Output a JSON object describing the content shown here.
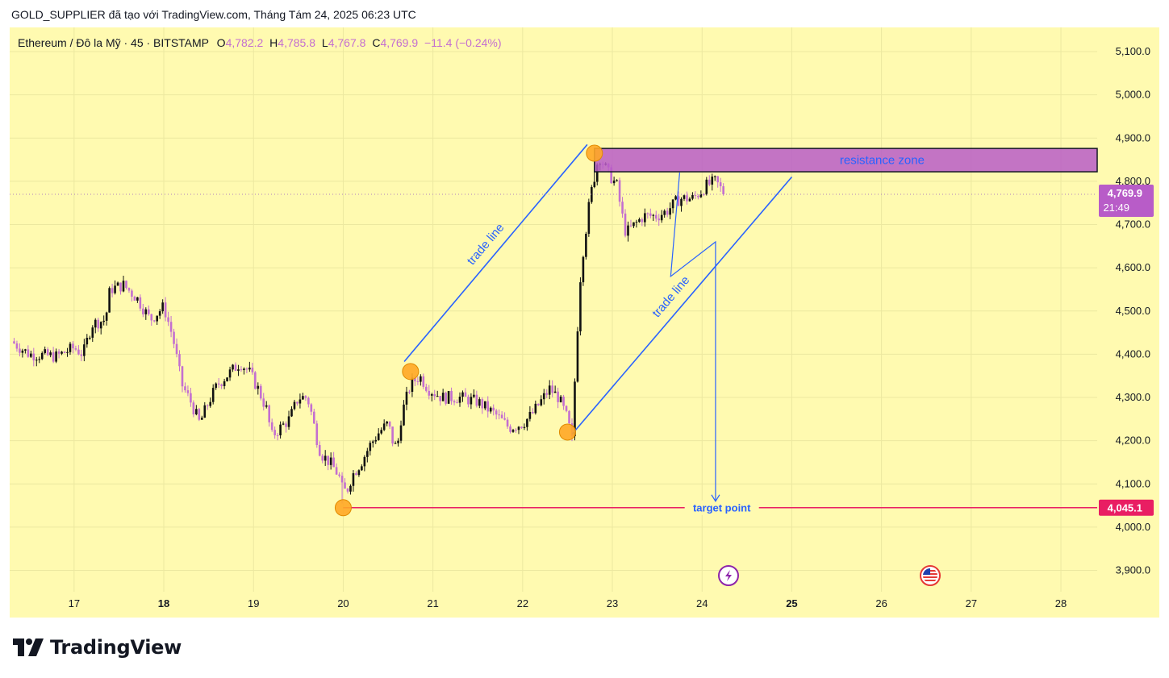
{
  "header": {
    "title": "GOLD_SUPPLIER đã tạo với TradingView.com, Tháng Tám 24, 2025 06:23 UTC"
  },
  "legend": {
    "symbol": "Ethereum / Đô la Mỹ · 45 · BITSTAMP",
    "o_label": "O",
    "o_value": "4,782.2",
    "h_label": "H",
    "h_value": "4,785.8",
    "l_label": "L",
    "l_value": "4,767.8",
    "c_label": "C",
    "c_value": "4,769.9",
    "change": "−11.4 (−0.24%)"
  },
  "price_badge": {
    "price": "4,769.9",
    "countdown": "21:49"
  },
  "target_badge": {
    "price": "4,045.1"
  },
  "annotations": {
    "resistance": "resistance zone",
    "trade_line_1": "trade line",
    "trade_line_2": "trade line",
    "target": "target point"
  },
  "brand": {
    "name": "TradingView"
  },
  "icons": [
    "lightning-icon",
    "us-flag-icon",
    "tradingview-logo-icon"
  ],
  "colors": {
    "background": "#fffab0",
    "candle_up": "#111111",
    "candle_down": "#c46fd0",
    "trend_line": "#2962ff",
    "resistance_fill": "#b85cc8",
    "target_line": "#e91e63",
    "marker": "#ffa726"
  },
  "chart_data": {
    "type": "candlestick",
    "title": "",
    "xlabel": "",
    "ylabel": "",
    "ylim": [
      3840,
      5150
    ],
    "y_ticks": [
      3900,
      4000,
      4100,
      4200,
      4300,
      4400,
      4500,
      4600,
      4700,
      4800,
      4900,
      5000,
      5100
    ],
    "y_tick_labels": [
      "3,900.0",
      "4,000.0",
      "4,100.0",
      "4,200.0",
      "4,300.0",
      "4,400.0",
      "4,500.0",
      "4,600.0",
      "4,700.0",
      "4,800.0",
      "4,900.0",
      "5,000.0",
      "5,100.0"
    ],
    "x_range": [
      16.3,
      28.5
    ],
    "x_ticks": [
      {
        "label": "17",
        "day": 17,
        "bold": false
      },
      {
        "label": "18",
        "day": 18,
        "bold": true
      },
      {
        "label": "19",
        "day": 19,
        "bold": false
      },
      {
        "label": "20",
        "day": 20,
        "bold": false
      },
      {
        "label": "21",
        "day": 21,
        "bold": false
      },
      {
        "label": "22",
        "day": 22,
        "bold": false
      },
      {
        "label": "23",
        "day": 23,
        "bold": false
      },
      {
        "label": "24",
        "day": 24,
        "bold": false
      },
      {
        "label": "25",
        "day": 25,
        "bold": true
      },
      {
        "label": "26",
        "day": 26,
        "bold": false
      },
      {
        "label": "27",
        "day": 27,
        "bold": false
      },
      {
        "label": "28",
        "day": 28,
        "bold": false
      }
    ],
    "close_path": [
      [
        16.3,
        4430
      ],
      [
        16.5,
        4400
      ],
      [
        16.8,
        4395
      ],
      [
        17.0,
        4415
      ],
      [
        17.1,
        4400
      ],
      [
        17.2,
        4470
      ],
      [
        17.35,
        4480
      ],
      [
        17.4,
        4550
      ],
      [
        17.55,
        4560
      ],
      [
        17.7,
        4530
      ],
      [
        17.85,
        4480
      ],
      [
        18.0,
        4510
      ],
      [
        18.1,
        4440
      ],
      [
        18.2,
        4330
      ],
      [
        18.3,
        4290
      ],
      [
        18.4,
        4240
      ],
      [
        18.5,
        4290
      ],
      [
        18.6,
        4330
      ],
      [
        18.7,
        4350
      ],
      [
        18.85,
        4380
      ],
      [
        18.95,
        4360
      ],
      [
        19.05,
        4320
      ],
      [
        19.15,
        4270
      ],
      [
        19.2,
        4210
      ],
      [
        19.3,
        4230
      ],
      [
        19.4,
        4250
      ],
      [
        19.5,
        4300
      ],
      [
        19.6,
        4300
      ],
      [
        19.65,
        4260
      ],
      [
        19.7,
        4210
      ],
      [
        19.75,
        4170
      ],
      [
        19.85,
        4150
      ],
      [
        19.95,
        4120
      ],
      [
        20.0,
        4080
      ],
      [
        20.05,
        4090
      ],
      [
        20.1,
        4120
      ],
      [
        20.2,
        4150
      ],
      [
        20.3,
        4190
      ],
      [
        20.4,
        4220
      ],
      [
        20.5,
        4240
      ],
      [
        20.55,
        4200
      ],
      [
        20.6,
        4180
      ],
      [
        20.65,
        4260
      ],
      [
        20.75,
        4330
      ],
      [
        20.85,
        4350
      ],
      [
        20.95,
        4320
      ],
      [
        21.1,
        4300
      ],
      [
        21.3,
        4300
      ],
      [
        21.5,
        4290
      ],
      [
        21.7,
        4260
      ],
      [
        21.85,
        4230
      ],
      [
        22.0,
        4240
      ],
      [
        22.1,
        4260
      ],
      [
        22.2,
        4290
      ],
      [
        22.3,
        4320
      ],
      [
        22.4,
        4300
      ],
      [
        22.5,
        4250
      ],
      [
        22.55,
        4200
      ],
      [
        22.6,
        4420
      ],
      [
        22.65,
        4600
      ],
      [
        22.7,
        4680
      ],
      [
        22.75,
        4760
      ],
      [
        22.85,
        4860
      ],
      [
        22.95,
        4820
      ],
      [
        23.05,
        4790
      ],
      [
        23.1,
        4730
      ],
      [
        23.15,
        4680
      ],
      [
        23.25,
        4700
      ],
      [
        23.35,
        4720
      ],
      [
        23.5,
        4720
      ],
      [
        23.6,
        4730
      ],
      [
        23.75,
        4760
      ],
      [
        23.9,
        4760
      ],
      [
        24.05,
        4790
      ],
      [
        24.15,
        4800
      ],
      [
        24.25,
        4770
      ]
    ],
    "key_points": {
      "swing_low_20": {
        "x": 20.0,
        "y": 4045
      },
      "swing_low_20_7": {
        "x": 20.75,
        "y": 4360
      },
      "swing_low_22_5": {
        "x": 22.5,
        "y": 4220
      },
      "swing_high_22_8": {
        "x": 22.8,
        "y": 4865
      },
      "current_close": {
        "x": 24.25,
        "y": 4769.9
      }
    },
    "resistance_zone": {
      "x_start": 22.8,
      "y_low": 4822,
      "y_high": 4876
    },
    "trade_line_1": {
      "from": [
        20.68,
        4383
      ],
      "to": [
        22.72,
        4885
      ]
    },
    "trade_line_2": {
      "from": [
        22.55,
        4215
      ],
      "to": [
        25.0,
        4810
      ]
    },
    "projection": {
      "points": [
        [
          23.75,
          4820
        ],
        [
          23.65,
          4580
        ],
        [
          24.15,
          4660
        ],
        [
          24.15,
          4060
        ]
      ]
    },
    "target_level": {
      "y": 4045.1,
      "x_start": 20.0
    },
    "current_price": 4769.9
  }
}
